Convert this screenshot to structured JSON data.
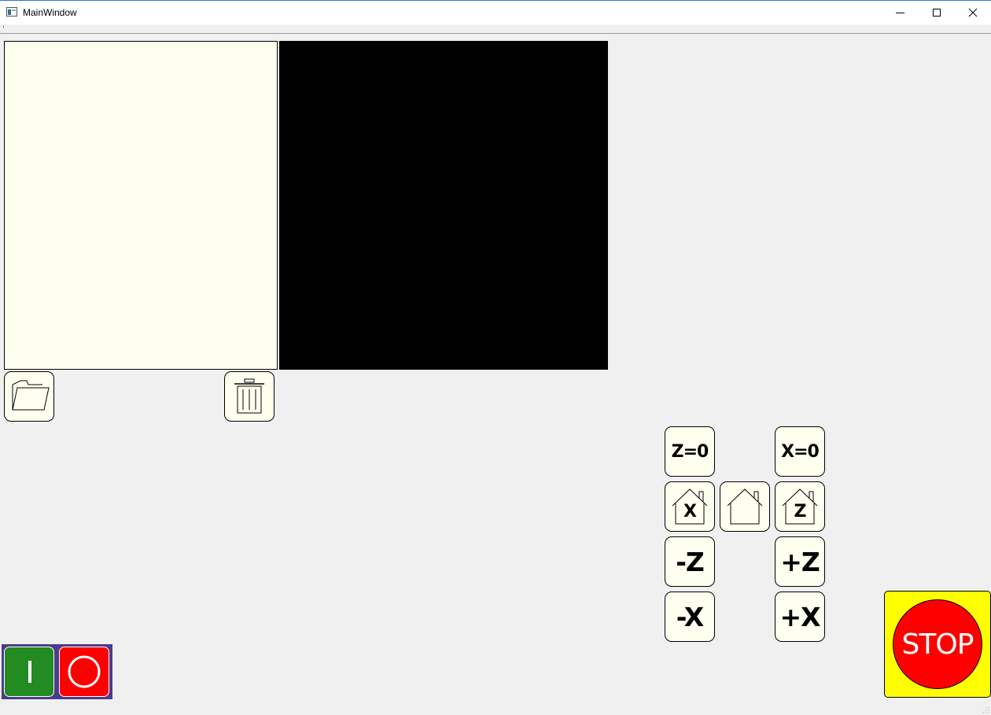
{
  "window": {
    "title": "MainWindow",
    "controls": [
      "minimize-icon",
      "maximize-icon",
      "close-icon"
    ]
  },
  "panels": {
    "file_list": {
      "background": "#fffff0"
    },
    "preview": {
      "background": "#000000"
    }
  },
  "file_actions": {
    "open_icon": "folder-open-icon",
    "delete_icon": "trash-icon"
  },
  "cnc": {
    "z_zero": "Z=0",
    "x_zero": "X=0",
    "home_x_label": "X",
    "home_z_label": "Z",
    "home_all_icon": "home-icon",
    "minus_z": "-Z",
    "plus_z": "+Z",
    "minus_x": "-X",
    "plus_x": "+X"
  },
  "power": {
    "on_icon": "power-on-icon",
    "off_icon": "power-off-icon",
    "on_color": "#228b22",
    "off_color": "#ff0000",
    "group_color": "#4b3b8c"
  },
  "stop": {
    "label": "STOP",
    "frame_color": "#ffff00",
    "button_color": "#ff0000"
  }
}
